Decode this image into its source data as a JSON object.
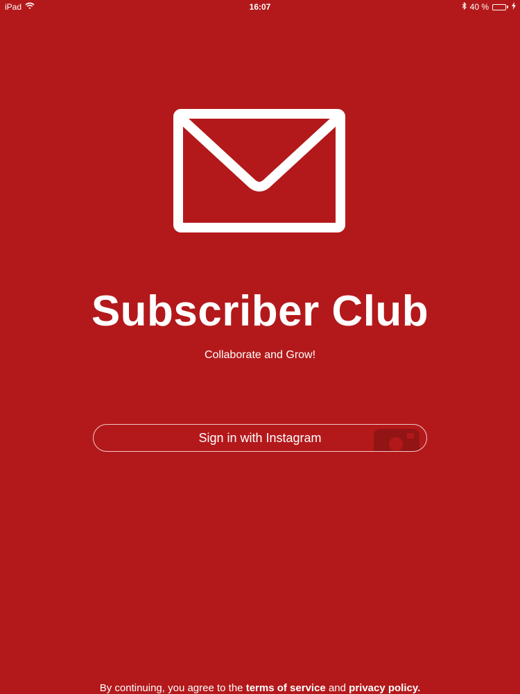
{
  "status_bar": {
    "device": "iPad",
    "time": "16:07",
    "battery_percent": "40 %",
    "battery_level": 0.4,
    "battery_color": "#4cd964"
  },
  "logo": {
    "icon": "envelope-icon"
  },
  "app": {
    "title": "Subscriber Club",
    "tagline": "Collaborate and Grow!"
  },
  "signin": {
    "label": "Sign in with Instagram",
    "icon": "instagram-icon"
  },
  "footer": {
    "prefix": "By continuing, you agree to the ",
    "terms_label": "terms of service",
    "middle": " and ",
    "privacy_label": "privacy policy."
  },
  "colors": {
    "background": "#b3191b",
    "foreground": "#ffffff"
  }
}
